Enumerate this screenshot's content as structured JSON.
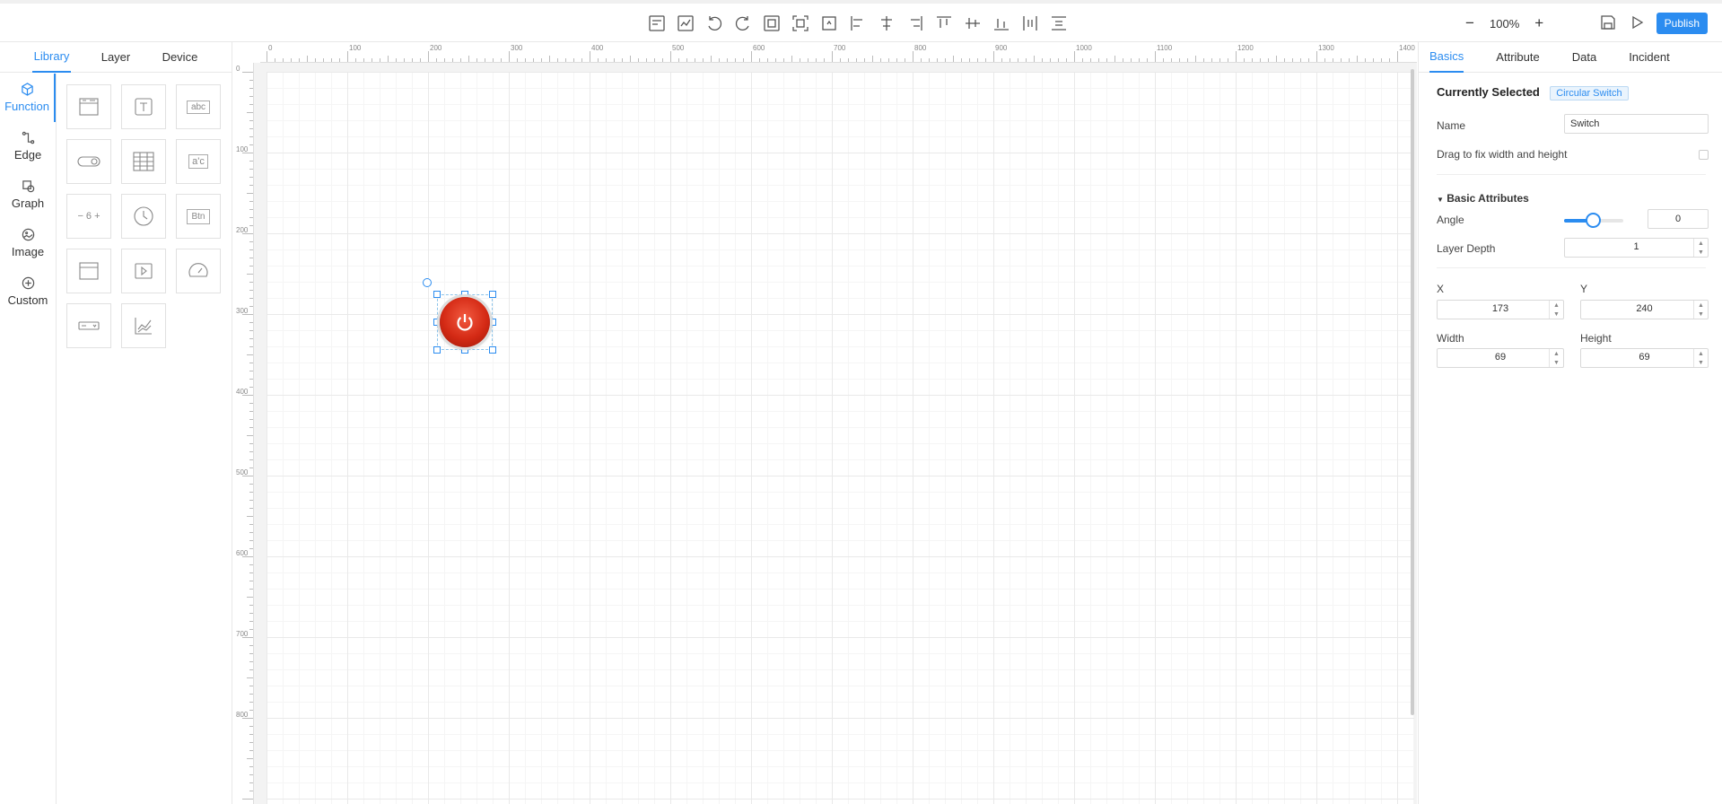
{
  "toolbar": {
    "tools": [
      "preview-icon",
      "chart-icon",
      "undo-icon",
      "redo-icon",
      "group-icon",
      "ungroup-icon",
      "bring-front-icon",
      "align-left-icon",
      "align-center-h-icon",
      "align-right-icon",
      "align-top-icon",
      "align-middle-v-icon",
      "align-bottom-icon",
      "distribute-h-icon",
      "distribute-v-icon"
    ],
    "zoom_out": "−",
    "zoom_level": "100%",
    "zoom_in": "+",
    "publish_label": "Publish"
  },
  "left_panel": {
    "tabs": [
      "Library",
      "Layer",
      "Device"
    ],
    "active_tab": "Library",
    "categories": [
      "Function",
      "Edge",
      "Graph",
      "Image",
      "Custom"
    ],
    "active_category": "Function",
    "components": [
      {
        "icon": "webpage-icon"
      },
      {
        "icon": "text-icon"
      },
      {
        "icon": "input-text-icon",
        "text": "abc"
      },
      {
        "icon": "switch-toggle-icon"
      },
      {
        "icon": "table-icon"
      },
      {
        "icon": "text-label-icon",
        "text": "a'c"
      },
      {
        "icon": "number-stepper-icon",
        "text": "− 6 +"
      },
      {
        "icon": "clock-icon"
      },
      {
        "icon": "button-icon",
        "text": "Btn"
      },
      {
        "icon": "window-icon"
      },
      {
        "icon": "video-icon"
      },
      {
        "icon": "gauge-icon"
      },
      {
        "icon": "dropdown-icon"
      },
      {
        "icon": "line-chart-icon"
      }
    ]
  },
  "ruler": {
    "top_ticks": [
      "0",
      "100",
      "200",
      "300",
      "400",
      "500",
      "600",
      "700",
      "800",
      "900",
      "1000",
      "1100",
      "1200",
      "1300",
      "1400"
    ],
    "left_ticks": [
      "0",
      "100",
      "200",
      "300",
      "400",
      "500",
      "600",
      "700",
      "800"
    ]
  },
  "properties": {
    "tabs": [
      "Basics",
      "Attribute",
      "Data",
      "Incident"
    ],
    "active_tab": "Basics",
    "currently_selected_label": "Currently Selected",
    "selected_type": "Circular Switch",
    "name_label": "Name",
    "name_value": "Switch",
    "drag_fix_label": "Drag to fix width and height",
    "basic_attributes_label": "Basic Attributes",
    "angle_label": "Angle",
    "angle_value": "0",
    "layer_depth_label": "Layer Depth",
    "layer_depth_value": "1",
    "x_label": "X",
    "x_value": "173",
    "y_label": "Y",
    "y_value": "240",
    "width_label": "Width",
    "width_value": "69",
    "height_label": "Height",
    "height_value": "69"
  },
  "colors": {
    "accent": "#2b8cf0",
    "switch_red": "#d42a15"
  }
}
